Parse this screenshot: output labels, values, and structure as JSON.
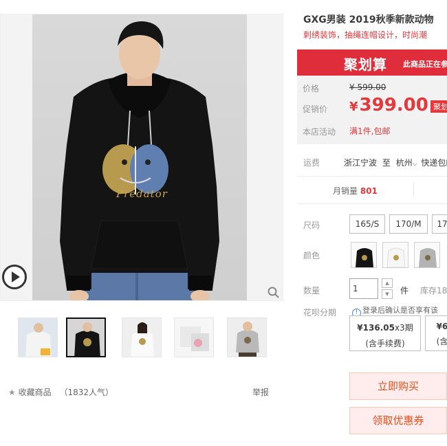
{
  "product": {
    "title": "GXG男装 2019秋季新款动物",
    "subtitle": "刺绣装饰，抽绳连帽设计，时尚潮",
    "print_text": "Predator"
  },
  "promo": {
    "brand": "聚划算",
    "note": "此商品正在参"
  },
  "price": {
    "label_price": "价格",
    "original": "¥ 599.00",
    "label_promo": "促销价",
    "currency": "¥",
    "promo_value": "399.00",
    "tag": "聚划",
    "label_activity": "本店活动",
    "activity": "满1件,包邮"
  },
  "shipping": {
    "label": "运费",
    "from": "浙江宁波",
    "to_word": "至",
    "dest": "杭州",
    "method": "快递包邮"
  },
  "sales": {
    "label": "月销量",
    "count": "801"
  },
  "size": {
    "label": "尺码",
    "options": [
      "165/S",
      "170/M",
      "17"
    ]
  },
  "color": {
    "label": "颜色"
  },
  "quantity": {
    "label": "数量",
    "value": "1",
    "unit": "件",
    "stock": "库存18"
  },
  "huabei": {
    "label": "花呗分期",
    "info": "登录后确认是否享有该",
    "plans": [
      {
        "amount": "¥136.05",
        "periods": "x3期",
        "fee": "(含手续费)"
      },
      {
        "amount": "¥6",
        "periods": "",
        "fee": "(含"
      }
    ]
  },
  "actions": {
    "buy": "立即购买",
    "coupon": "领取优惠券"
  },
  "favorite": {
    "label": "收藏商品",
    "count": "（1832人气）"
  },
  "report": "举报",
  "colors": {
    "accent": "#e4393c",
    "banner": "#e02d3b",
    "button_bg": "#ffeded",
    "button_text": "#e5511d"
  }
}
